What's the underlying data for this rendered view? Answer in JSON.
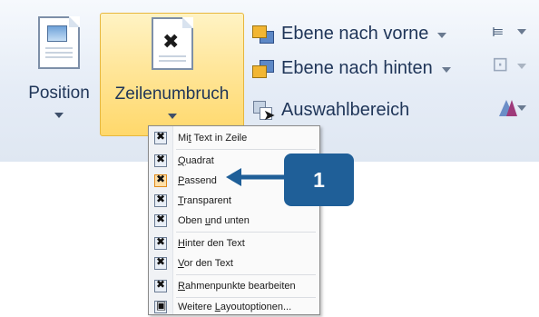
{
  "ribbon": {
    "position_button": {
      "label": "Position",
      "icon": "position-icon"
    },
    "wrap_button": {
      "label": "Zeilenumbruch",
      "icon": "text-wrap-icon"
    },
    "bring_forward": {
      "label": "Ebene nach vorne",
      "icon": "bring-forward-icon"
    },
    "send_backward": {
      "label": "Ebene nach hinten",
      "icon": "send-backward-icon"
    },
    "selection_pane": {
      "label": "Auswahlbereich",
      "icon": "selection-pane-icon"
    },
    "align": {
      "icon": "align-icon"
    },
    "group": {
      "icon": "group-icon"
    },
    "rotate": {
      "icon": "rotate-icon"
    },
    "group_label_fragment": "n"
  },
  "menu": {
    "items": [
      {
        "pre": "Mi",
        "mn": "t",
        "post": " Text in Zeile",
        "icon": "inline-with-text-icon"
      },
      {
        "pre": "",
        "mn": "Q",
        "post": "uadrat",
        "icon": "square-wrap-icon"
      },
      {
        "pre": "",
        "mn": "P",
        "post": "assend",
        "icon": "tight-wrap-icon",
        "highlighted": true
      },
      {
        "pre": "",
        "mn": "T",
        "post": "ransparent",
        "icon": "through-wrap-icon"
      },
      {
        "pre": "Oben ",
        "mn": "u",
        "post": "nd unten",
        "icon": "top-bottom-wrap-icon"
      },
      {
        "pre": "",
        "mn": "H",
        "post": "inter den Text",
        "icon": "behind-text-icon"
      },
      {
        "pre": "",
        "mn": "V",
        "post": "or den Text",
        "icon": "in-front-of-text-icon"
      },
      {
        "pre": "",
        "mn": "R",
        "post": "ahmenpunkte bearbeiten",
        "icon": "edit-wrap-points-icon"
      },
      {
        "pre": "Weitere ",
        "mn": "L",
        "post": "ayoutoptionen...",
        "icon": "more-layout-options-icon"
      }
    ]
  },
  "callout": {
    "number": "1"
  },
  "colors": {
    "accent": "#1f5f98",
    "hover": "#ffd86b",
    "ribbon_text": "#1f3558"
  }
}
